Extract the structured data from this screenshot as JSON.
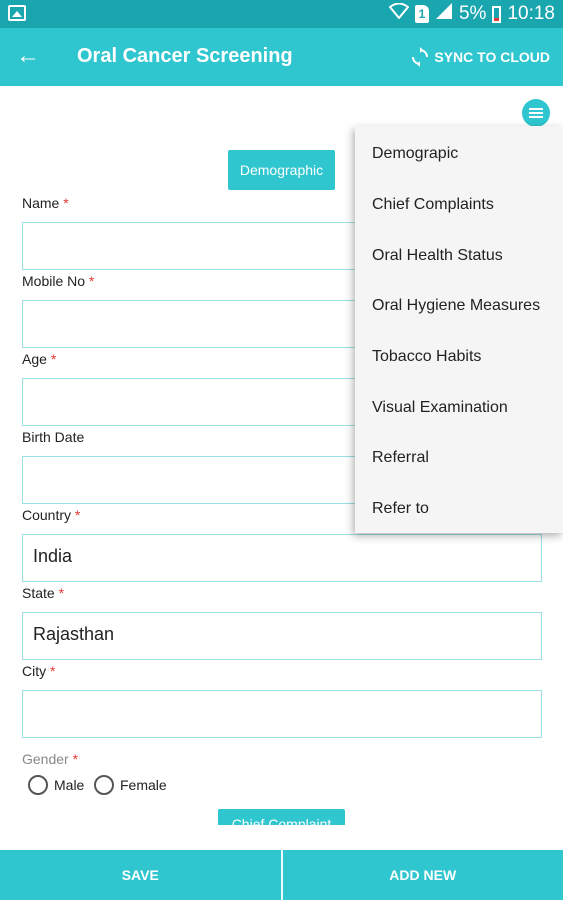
{
  "status_bar": {
    "battery": "5%",
    "time": "10:18",
    "sim_label": "1"
  },
  "app_bar": {
    "title": "Oral Cancer Screening",
    "sync_label": "SYNC TO CLOUD"
  },
  "form": {
    "section_button": "Demographic",
    "next_section_button": "Chief Complaint",
    "fields": [
      {
        "label": "Name",
        "required": "*",
        "value": ""
      },
      {
        "label": "Mobile No",
        "required": "*",
        "value": ""
      },
      {
        "label": "Age",
        "required": "*",
        "value": ""
      },
      {
        "label": "Birth Date",
        "required": "",
        "value": ""
      },
      {
        "label": "Country",
        "required": "*",
        "value": "India"
      },
      {
        "label": "State",
        "required": "*",
        "value": "Rajasthan"
      },
      {
        "label": "City",
        "required": "*",
        "value": ""
      }
    ],
    "gender": {
      "label": "Gender",
      "required": "*",
      "options": [
        "Male",
        "Female"
      ]
    }
  },
  "menu": {
    "items": [
      "Demograpic",
      "Chief Complaints",
      "Oral Health Status",
      "Oral Hygiene Measures",
      "Tobacco Habits",
      "Visual Examination",
      "Referral",
      "Refer to"
    ]
  },
  "bottom_bar": {
    "save_label": "SAVE",
    "add_new_label": "ADD NEW"
  },
  "colors": {
    "primary": "#2fc6cf",
    "status_bar": "#1aa6ae",
    "required": "#e53935"
  }
}
